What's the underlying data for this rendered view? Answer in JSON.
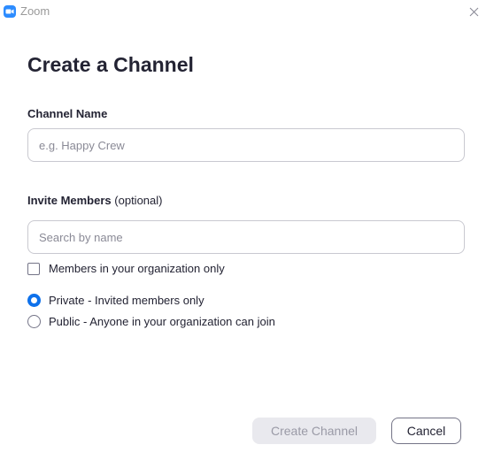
{
  "window": {
    "app_title": "Zoom",
    "accent_color": "#2D8CFF"
  },
  "dialog": {
    "heading": "Create a Channel",
    "channel_name": {
      "label": "Channel Name",
      "placeholder": "e.g. Happy Crew",
      "value": ""
    },
    "invite_members": {
      "label": "Invite Members",
      "optional_text": "(optional)",
      "placeholder": "Search by name",
      "value": ""
    },
    "org_only_checkbox": {
      "label": "Members in your organization only",
      "checked": false
    },
    "visibility_options": [
      {
        "label": "Private - Invited members only",
        "selected": true
      },
      {
        "label": "Public - Anyone in your organization can join",
        "selected": false
      }
    ],
    "buttons": {
      "create_label": "Create Channel",
      "create_enabled": false,
      "cancel_label": "Cancel"
    }
  },
  "icons": {
    "app": "zoom-camera-icon",
    "close": "close-icon"
  }
}
